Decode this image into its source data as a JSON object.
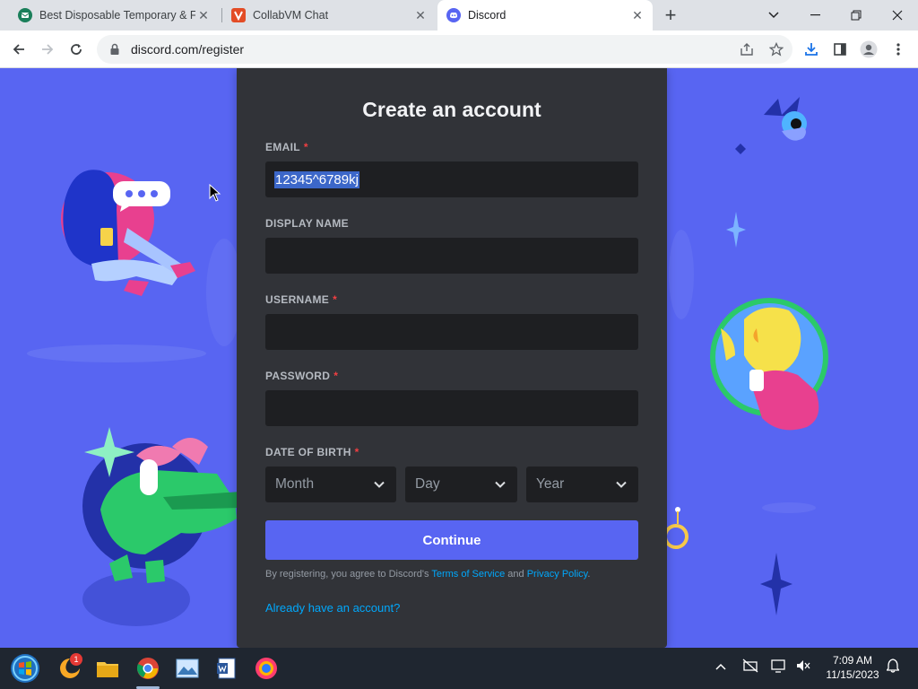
{
  "browser": {
    "tabs": [
      {
        "title": "Best Disposable Temporary & Fa",
        "icon": "tempmail-icon"
      },
      {
        "title": "CollabVM Chat",
        "icon": "collabvm-icon"
      },
      {
        "title": "Discord",
        "icon": "discord-icon",
        "active": true
      }
    ],
    "url": "discord.com/register"
  },
  "form": {
    "title": "Create an account",
    "email_label": "EMAIL",
    "email_value": "12345^6789kj",
    "display_name_label": "DISPLAY NAME",
    "username_label": "USERNAME",
    "password_label": "PASSWORD",
    "dob_label": "DATE OF BIRTH",
    "required_mark": "*",
    "month_placeholder": "Month",
    "day_placeholder": "Day",
    "year_placeholder": "Year",
    "continue_label": "Continue",
    "terms_prefix": "By registering, you agree to Discord's ",
    "terms_link": "Terms of Service",
    "terms_and": " and ",
    "privacy_link": "Privacy Policy",
    "terms_suffix": ".",
    "already_link": "Already have an account?"
  },
  "taskbar": {
    "time": "7:09 AM",
    "date": "11/15/2023",
    "notification_badge": "1"
  },
  "colors": {
    "brand": "#5865f2",
    "card": "#313338",
    "input": "#1e1f22",
    "link": "#00a8fc",
    "required": "#f23f42"
  }
}
